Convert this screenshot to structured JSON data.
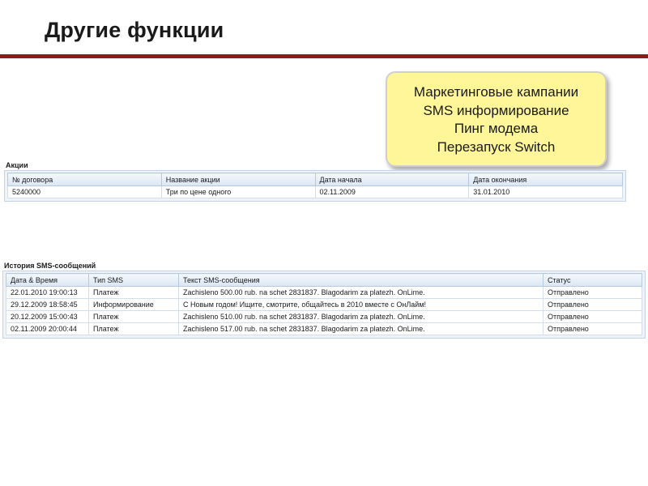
{
  "slide": {
    "title": "Другие функции"
  },
  "callout": {
    "lines": [
      "Маркетинговые кампании",
      "SMS информирование",
      "Пинг модема",
      "Перезапуск Switch"
    ]
  },
  "actions": {
    "title": "Акции",
    "columns": [
      "№ договора",
      "Название акции",
      "Дата начала",
      "Дата окончания"
    ],
    "rows": [
      [
        "5240000",
        "Три по цене одного",
        "02.11.2009",
        "31.01.2010"
      ]
    ]
  },
  "sms_history": {
    "title": "История SMS-сообщений",
    "columns": [
      "Дата & Время",
      "Тип SMS",
      "Текст SMS-сообщения",
      "Статус"
    ],
    "rows": [
      [
        "22.01.2010 19:00:13",
        "Платеж",
        "Zachisleno 500.00 rub. na schet 2831837. Blagodarim za platezh. OnLime.",
        "Отправлено"
      ],
      [
        "29.12.2009 18:58:45",
        "Информирование",
        "С Новым годом! Ищите, смотрите, общайтесь в 2010 вместе с ОнЛайм!",
        "Отправлено"
      ],
      [
        "20.12.2009 15:00:43",
        "Платеж",
        "Zachisleno 510.00 rub. na schet 2831837. Blagodarim za platezh. OnLime.",
        "Отправлено"
      ],
      [
        "02.11.2009 20:00:44",
        "Платеж",
        "Zachisleno 517.00 rub. na schet 2831837. Blagodarim za platezh. OnLime.",
        "Отправлено"
      ]
    ]
  },
  "colors": {
    "title_rule": "#8a1f1a",
    "callout_bg": "#fff69a",
    "grid_header_bg": "#dbe6f2"
  }
}
